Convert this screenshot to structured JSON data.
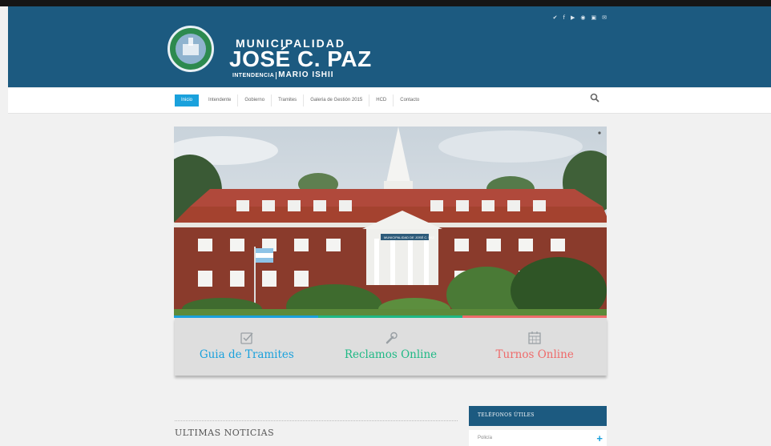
{
  "social": [
    "twitter-icon",
    "facebook-icon",
    "youtube-icon",
    "rss-icon",
    "instagram-icon",
    "email-icon"
  ],
  "logo": {
    "line1": "MUNICIPALIDAD",
    "line2": "JOSÉ C. PAZ",
    "line3_prefix": "INTENDENCIA",
    "line3_name": "MARIO ISHII"
  },
  "nav": {
    "items": [
      "Inicio",
      "Intendente",
      "Gobierno",
      "Tramites",
      "Galeria de Gestión 2015",
      "HCD",
      "Contacto"
    ],
    "search_icon": "search-icon"
  },
  "hero": {
    "sign_text": "MUNICIPALIDAD DE JOSÉ C. PAZ"
  },
  "colors": {
    "blue": "#1aa1dc",
    "green": "#1fb985",
    "red": "#ef6b6b",
    "header": "#1c5a80"
  },
  "cards": [
    {
      "label": "Guia de Tramites",
      "icon": "checkbox-icon",
      "color": "#1aa1dc"
    },
    {
      "label": "Reclamos Online",
      "icon": "wrench-icon",
      "color": "#1fb985"
    },
    {
      "label": "Turnos Online",
      "icon": "calendar-icon",
      "color": "#ef6b6b"
    }
  ],
  "news": {
    "title": "ULTIMAS NOTICIAS"
  },
  "sidebar": {
    "title": "TELÉFONOS ÚTILES",
    "first_item": "Policía"
  }
}
